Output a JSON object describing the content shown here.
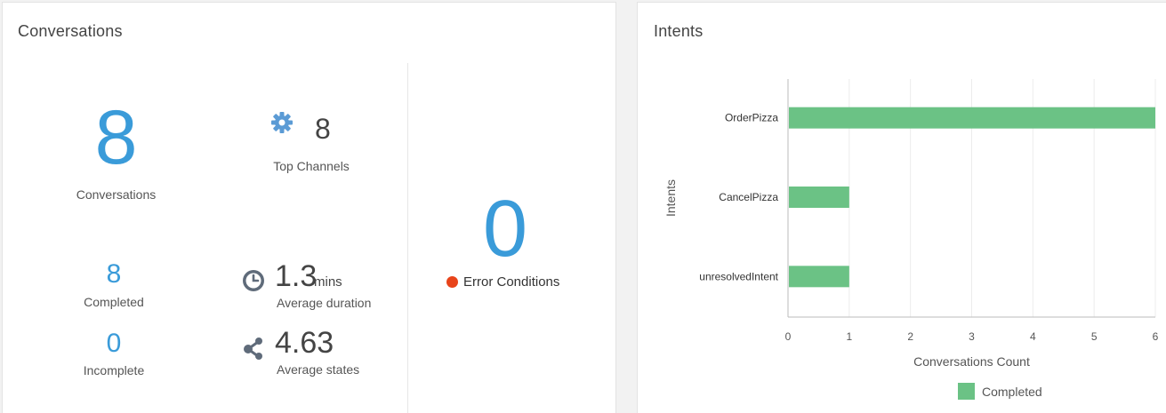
{
  "conversations_panel": {
    "title": "Conversations",
    "total": {
      "value": "8",
      "label": "Conversations"
    },
    "top_channels": {
      "value": "8",
      "label": "Top Channels",
      "icon": "gear-icon"
    },
    "completed": {
      "value": "8",
      "label": "Completed"
    },
    "incomplete": {
      "value": "0",
      "label": "Incomplete"
    },
    "average_duration": {
      "value": "1.3",
      "unit": "mins",
      "label": "Average duration",
      "icon": "clock-icon"
    },
    "average_states": {
      "value": "4.63",
      "label": "Average states",
      "icon": "share-nodes-icon"
    },
    "error_conditions": {
      "value": "0",
      "label": "Error Conditions",
      "dot_color": "#e8441a"
    }
  },
  "intents_panel": {
    "title": "Intents"
  },
  "colors": {
    "accent": "#3a9bd9",
    "bar": "#6bc285"
  },
  "chart_data": {
    "type": "bar",
    "orientation": "horizontal",
    "categories": [
      "OrderPizza",
      "CancelPizza",
      "unresolvedIntent"
    ],
    "series": [
      {
        "name": "Completed",
        "values": [
          6,
          1,
          1
        ],
        "color": "#6bc285"
      }
    ],
    "xlabel": "Conversations Count",
    "ylabel": "Intents",
    "xlim": [
      0,
      6
    ],
    "xticks": [
      "0",
      "1",
      "2",
      "3",
      "4",
      "5",
      "6"
    ],
    "grid": true,
    "legend": "bottom"
  }
}
